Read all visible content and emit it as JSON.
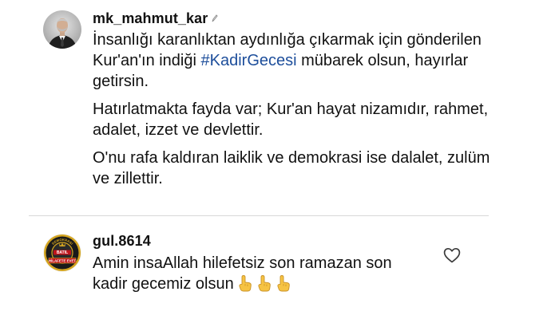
{
  "post": {
    "username": "mk_mahmut_kar",
    "edited_icon": "pen-icon",
    "paragraph_1_before": "İnsanlığı karanlıktan aydınlığa çıkarmak için gönderilen Kur'an'ın indiği ",
    "paragraph_1_hashtag": "#KadirGecesi",
    "paragraph_1_after": " mübarek olsun, hayırlar getirsin.",
    "paragraph_2": "Hatırlatmakta fayda var; Kur'an hayat nizamıdır, rahmet, adalet, izzet ve devlettir.",
    "paragraph_3": "O'nu rafa kaldıran laiklik ve demokrasi ise dalalet, zulüm ve zillettir."
  },
  "comment": {
    "username": "gul.8614",
    "text": "Amin insaAllah hilefetsiz son ramazan son kadir gecemiz olsun",
    "emojis": [
      "pointing-up-emoji",
      "pointing-up-emoji",
      "pointing-up-emoji"
    ],
    "like_icon": "heart-icon",
    "avatar_badge": {
      "top_text": "DEMOKRASİ",
      "center_text": "BATIL",
      "bottom_text": "HİLAFETE EVET"
    }
  },
  "colors": {
    "text": "#111111",
    "hashtag": "#1d4e9b",
    "divider": "#d8d8d8",
    "badge_gold": "#d4a520",
    "badge_red": "#c0141a"
  }
}
